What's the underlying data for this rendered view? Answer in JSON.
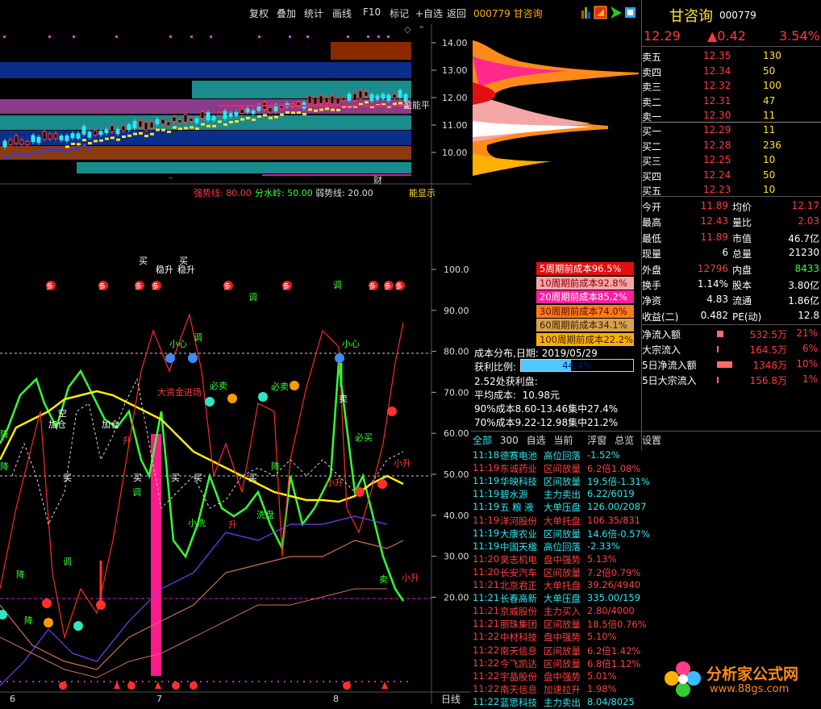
{
  "menu": {
    "items": [
      "复权",
      "叠加",
      "统计",
      "画线",
      "F10",
      "标记",
      "+自选",
      "返回"
    ],
    "code_name": "000779 甘咨询"
  },
  "quote": {
    "name": "甘咨询",
    "code": "000779",
    "price": "12.29",
    "change": "▲0.42",
    "change_pct": "3.54%"
  },
  "order_book": {
    "asks": [
      {
        "label": "卖五",
        "price": "12.35",
        "vol": "130"
      },
      {
        "label": "卖四",
        "price": "12.34",
        "vol": "50"
      },
      {
        "label": "卖三",
        "price": "12.32",
        "vol": "100"
      },
      {
        "label": "卖二",
        "price": "12.31",
        "vol": "47"
      },
      {
        "label": "卖一",
        "price": "12.30",
        "vol": "11"
      }
    ],
    "bids": [
      {
        "label": "买一",
        "price": "12.29",
        "vol": "11"
      },
      {
        "label": "买二",
        "price": "12.28",
        "vol": "236"
      },
      {
        "label": "买三",
        "price": "12.25",
        "vol": "10"
      },
      {
        "label": "买四",
        "price": "12.24",
        "vol": "50"
      },
      {
        "label": "买五",
        "price": "12.23",
        "vol": "10"
      }
    ]
  },
  "stats": [
    {
      "l1": "今开",
      "v1": "11.89",
      "l2": "均价",
      "v2": "12.17"
    },
    {
      "l1": "最高",
      "v1": "12.43",
      "l2": "量比",
      "v2": "2.03"
    },
    {
      "l1": "最低",
      "v1": "11.89",
      "l2": "市值",
      "v2": "46.7亿"
    },
    {
      "l1": "现量",
      "v1": "6",
      "l2": "总量",
      "v2": "21230"
    },
    {
      "l1": "外盘",
      "v1": "12796",
      "l2": "内盘",
      "v2": "8433"
    },
    {
      "l1": "换手",
      "v1": "1.14%",
      "l2": "股本",
      "v2": "3.80亿"
    },
    {
      "l1": "净资",
      "v1": "4.83",
      "l2": "流通",
      "v2": "1.86亿"
    },
    {
      "l1": "收益(二)",
      "v1": "0.482",
      "l2": "PE(动)",
      "v2": "12.8"
    }
  ],
  "flows": [
    {
      "label": "净流入额",
      "value": "532.5万",
      "pct": "21%",
      "bar": 0.16
    },
    {
      "label": "大宗流入",
      "value": "164.5万",
      "pct": "6%",
      "bar": 0.04
    },
    {
      "label": "5日净流入额",
      "value": "1348万",
      "pct": "10%",
      "bar": 0.38
    },
    {
      "label": "5日大宗流入",
      "value": "156.8万",
      "pct": "1%",
      "bar": 0.03
    }
  ],
  "cost_periods": [
    {
      "text": "5周期前成本96.5%",
      "color": "#e01010",
      "fg": "#ffffff"
    },
    {
      "text": "10周期前成本92.8%",
      "color": "#f4a6a6",
      "fg": "#8b0000"
    },
    {
      "text": "20周期前成本85.2%",
      "color": "#ff1ea0",
      "fg": "#ffffff"
    },
    {
      "text": "30周期前成本74.0%",
      "color": "#ff7a1a",
      "fg": "#5a1000"
    },
    {
      "text": "60周期前成本34.1%",
      "color": "#d9a050",
      "fg": "#3a2000"
    },
    {
      "text": "100周期前成本22.2%",
      "color": "#ffb000",
      "fg": "#3a2000"
    }
  ],
  "cost_dist": {
    "date_label": "成本分布,日期:",
    "date": "2019/05/29",
    "profit_label": "获利比例:",
    "profit": "44.4%",
    "profit_ratio": 0.444,
    "profit_price": "2.52处获利盘:",
    "avg_cost": "平均成本:  10.98元",
    "c90": "90%成本8.60-13.46集中27.4%",
    "c70": "70%成本9.22-12.98集中21.2%"
  },
  "tabs": [
    "全部",
    "300",
    "自选",
    "当前",
    "浮窗",
    "总览",
    "设置"
  ],
  "ticker": [
    {
      "time": "11:18",
      "name": "德赛电池",
      "event": "高位回落",
      "val": "-1.52%",
      "tc": "cyan"
    },
    {
      "time": "11:19",
      "name": "东诚药业",
      "event": "区间放量",
      "val": "6.2倍1.08%",
      "tc": "red"
    },
    {
      "time": "11:19",
      "name": "华映科技",
      "event": "区间放量",
      "val": "19.5倍-1.31%",
      "tc": "cyan"
    },
    {
      "time": "11:19",
      "name": "碧水源",
      "event": "主力卖出",
      "val": "6.22/6019",
      "tc": "cyan"
    },
    {
      "time": "11:19",
      "name": "五 粮 液",
      "event": "大单压盘",
      "val": "126.00/2087",
      "tc": "cyan"
    },
    {
      "time": "11:19",
      "name": "洋河股份",
      "event": "大单托盘",
      "val": "106.35/831",
      "tc": "red"
    },
    {
      "time": "11:19",
      "name": "大康农业",
      "event": "区间放量",
      "val": "14.6倍-0.57%",
      "tc": "cyan"
    },
    {
      "time": "11:19",
      "name": "中国天楹",
      "event": "高位回落",
      "val": "-2.33%",
      "tc": "cyan"
    },
    {
      "time": "11:20",
      "name": "昊志机电",
      "event": "盘中强势",
      "val": "5.13%",
      "tc": "red"
    },
    {
      "time": "11:20",
      "name": "长安汽车",
      "event": "区间放量",
      "val": "7.2倍0.79%",
      "tc": "red"
    },
    {
      "time": "11:21",
      "name": "北京君正",
      "event": "大单托盘",
      "val": "39.26/4940",
      "tc": "red"
    },
    {
      "time": "11:21",
      "name": "长春高新",
      "event": "大单压盘",
      "val": "335.00/159",
      "tc": "cyan"
    },
    {
      "time": "11:21",
      "name": "京威股份",
      "event": "主力买入",
      "val": "2.80/4000",
      "tc": "red"
    },
    {
      "time": "11:21",
      "name": "丽珠集团",
      "event": "区间放量",
      "val": "18.5倍0.76%",
      "tc": "red"
    },
    {
      "time": "11:22",
      "name": "中材科技",
      "event": "盘中强势",
      "val": "5.10%",
      "tc": "red"
    },
    {
      "time": "11:22",
      "name": "南天信息",
      "event": "区间放量",
      "val": "6.2倍1.42%",
      "tc": "red"
    },
    {
      "time": "11:22",
      "name": "今飞凯达",
      "event": "区间放量",
      "val": "6.8倍1.12%",
      "tc": "red"
    },
    {
      "time": "11:22",
      "name": "宇晶股份",
      "event": "盘中强势",
      "val": "5.01%",
      "tc": "red"
    },
    {
      "time": "11:22",
      "name": "南天信息",
      "event": "加速拉升",
      "val": "1.98%",
      "tc": "red"
    },
    {
      "time": "11:22",
      "name": "蓝思科技",
      "event": "主力卖出",
      "val": "8.04/8025",
      "tc": "cyan"
    }
  ],
  "indicator_legend": {
    "strong": "强势线: 80.00",
    "water": "分水岭: 50.00",
    "weak": "弱势线: 20.00",
    "right": "能显示"
  },
  "price_axis": [
    "14.00",
    "13.00",
    "12.00",
    "11.00",
    "10.00"
  ],
  "ind_axis": [
    "100.0",
    "90.00",
    "80.00",
    "70.00",
    "60.00",
    "50.00",
    "40.00",
    "30.00",
    "20.00"
  ],
  "x_axis": [
    "6",
    "7",
    "8"
  ],
  "period_label": "日线",
  "price_marks": {
    "label_r": "盈能平",
    "cai": "财"
  },
  "indicator_text": {
    "mai": "买",
    "wensheng": "稳升",
    "duo": "多",
    "tiao": "调",
    "xiaoxin": "小心",
    "bimai": "必卖",
    "jiacang": "加仓",
    "kong": "空",
    "jiang": "降",
    "dajiang": "大资金进场",
    "sheng": "升",
    "xiaosheng": "小升",
    "xiaoxi": "小洗",
    "xipan": "洗盘",
    "xuan": "选",
    "mai_sell": "卖",
    "bimaiy": "必买"
  },
  "watermark": {
    "title": "分析家公式网",
    "url": "www.88gs.com"
  }
}
